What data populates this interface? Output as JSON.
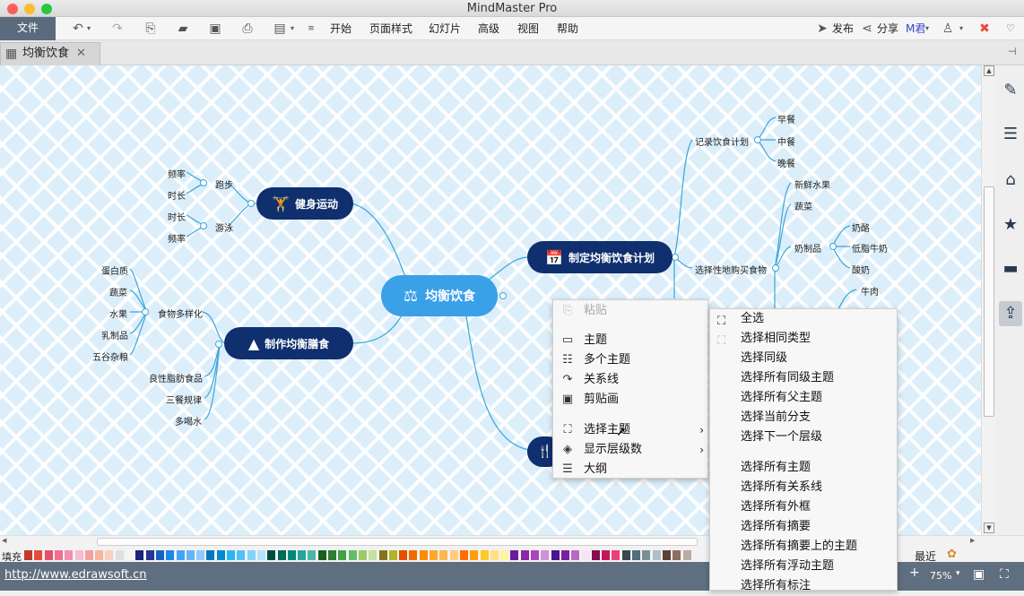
{
  "app": {
    "title": "MindMaster Pro"
  },
  "menubar": {
    "file": "文件",
    "items": [
      "开始",
      "页面样式",
      "幻灯片",
      "高级",
      "视图",
      "帮助"
    ],
    "publish": "发布",
    "share": "分享",
    "user": "M君"
  },
  "tab": {
    "title": "均衡饮食"
  },
  "mindmap": {
    "center": "均衡饮食",
    "topics": {
      "fitness": "健身运动",
      "plan": "制定均衡饮食计划",
      "meal": "制作均衡膳食"
    },
    "fitness": {
      "run": "跑步",
      "run_freq": "频率",
      "run_dur": "时长",
      "swim": "游泳",
      "swim_dur": "时长",
      "swim_freq": "频率"
    },
    "meal": {
      "variety": "食物多样化",
      "foods": [
        "蛋白质",
        "蔬菜",
        "水果",
        "乳制品",
        "五谷杂粮"
      ],
      "others": [
        "良性脂肪食品",
        "三餐规律",
        "多喝水"
      ]
    },
    "plan": {
      "record": "记录饮食计划",
      "meals": [
        "早餐",
        "中餐",
        "晚餐"
      ],
      "buy": "选择性地购买食物",
      "buy_items": [
        "新鲜水果",
        "蔬菜",
        "奶制品"
      ],
      "dairy": [
        "奶酪",
        "低脂牛奶",
        "酸奶"
      ],
      "beef": "牛肉"
    }
  },
  "context_menu": {
    "items": [
      {
        "label": "粘贴",
        "icon": "paste-icon",
        "disabled": true
      },
      {
        "label": "主题",
        "icon": "topic-icon"
      },
      {
        "label": "多个主题",
        "icon": "multi-topic-icon"
      },
      {
        "label": "关系线",
        "icon": "relationship-icon"
      },
      {
        "label": "剪贴画",
        "icon": "clipart-icon"
      },
      {
        "label": "选择主题",
        "icon": "select-icon"
      },
      {
        "label": "显示层级数",
        "icon": "layers-icon"
      },
      {
        "label": "大纲",
        "icon": "outline-icon"
      }
    ]
  },
  "submenu": {
    "items": [
      {
        "label": "全选",
        "disabled": false
      },
      {
        "label": "选择相同类型",
        "disabled": true
      },
      {
        "label": "选择同级",
        "disabled": true
      },
      {
        "label": "选择所有同级主题",
        "disabled": true
      },
      {
        "label": "选择所有父主题",
        "disabled": true
      },
      {
        "label": "选择当前分支",
        "disabled": true
      },
      {
        "label": "选择下一个层级",
        "disabled": true
      },
      {
        "label": "选择所有主题",
        "disabled": false
      },
      {
        "label": "选择所有关系线",
        "disabled": false
      },
      {
        "label": "选择所有外框",
        "disabled": false
      },
      {
        "label": "选择所有摘要",
        "disabled": false
      },
      {
        "label": "选择所有摘要上的主题",
        "disabled": false
      },
      {
        "label": "选择所有浮动主题",
        "disabled": false
      },
      {
        "label": "选择所有标注",
        "disabled": false
      }
    ]
  },
  "colorbar": {
    "fill_label": "填充",
    "recent_label": "最近"
  },
  "status": {
    "url": "http://www.edrawsoft.cn",
    "zoom": "75%"
  },
  "palette": [
    "#c0392b",
    "#e74c3c",
    "#e84f6b",
    "#ef6f8f",
    "#f48fb1",
    "#f8bbd0",
    "#f5a0a0",
    "#f6b5a0",
    "#f9d0c0",
    "#e0e0e0",
    "#f5f5f5",
    "#1a237e",
    "#283593",
    "#1565c0",
    "#1e88e5",
    "#42a5f5",
    "#64b5f6",
    "#90caf9",
    "#0277bd",
    "#0288d1",
    "#29b6f6",
    "#4fc3f7",
    "#81d4fa",
    "#b3e5fc",
    "#004d40",
    "#00695c",
    "#00897b",
    "#26a69a",
    "#4db6ac",
    "#1b5e20",
    "#2e7d32",
    "#43a047",
    "#66bb6a",
    "#9ccc65",
    "#c5e1a5",
    "#827717",
    "#afb42b",
    "#e65100",
    "#ef6c00",
    "#fb8c00",
    "#ffa726",
    "#ffb74d",
    "#ffcc80",
    "#ff6f00",
    "#ffa000",
    "#ffca28",
    "#ffe082",
    "#fff59d",
    "#6a1b9a",
    "#8e24aa",
    "#ab47bc",
    "#ce93d8",
    "#4a148c",
    "#7b1fa2",
    "#ba68c8",
    "#f3e5f5",
    "#880e4f",
    "#c2185b",
    "#ec407a",
    "#37474f",
    "#546e7a",
    "#78909c",
    "#b0bec5",
    "#5d4037",
    "#8d6e63",
    "#bcaaa4"
  ]
}
